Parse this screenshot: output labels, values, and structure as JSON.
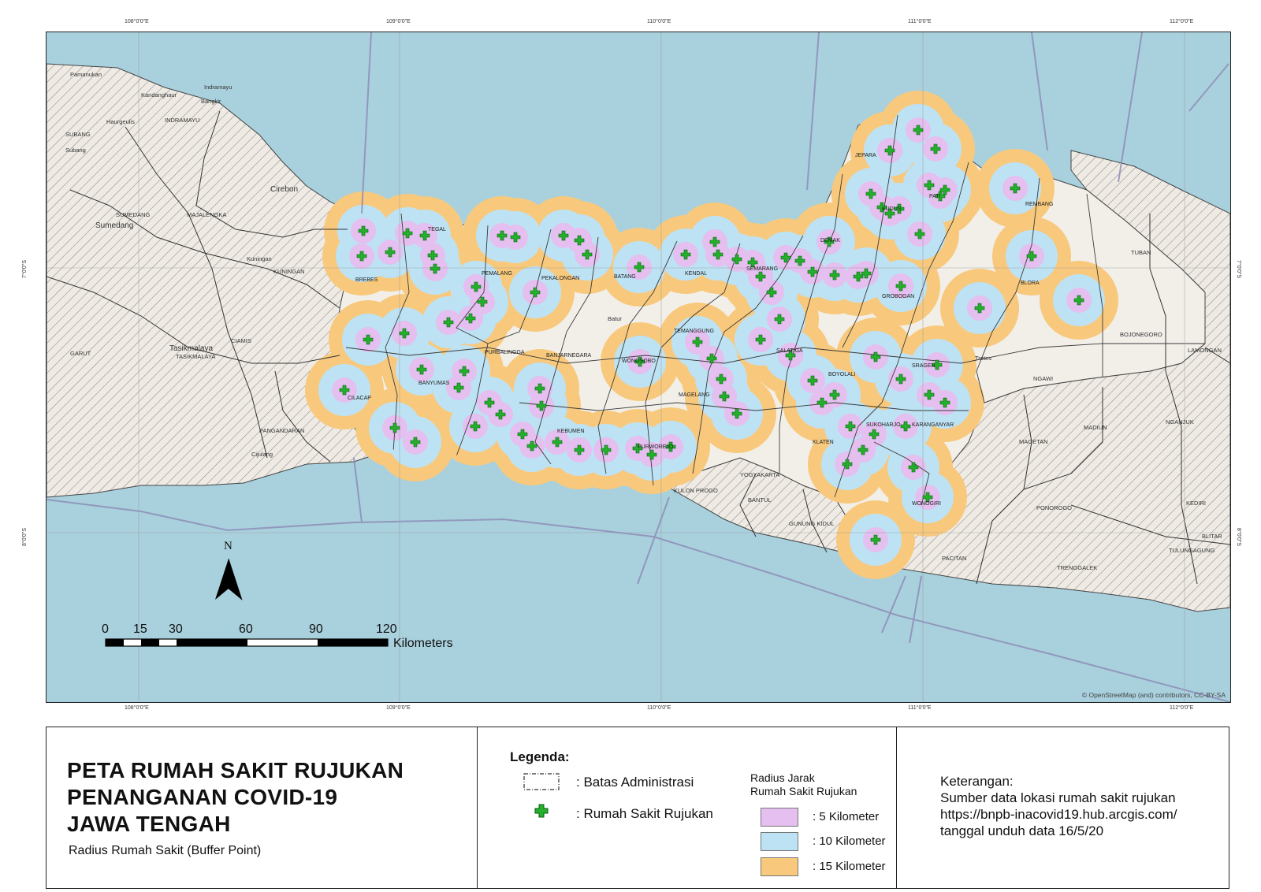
{
  "map": {
    "lon_labels": [
      "108°0'0\"E",
      "109°0'0\"E",
      "110°0'0\"E",
      "111°0'0\"E",
      "112°0'0\"E"
    ],
    "lat_labels": [
      "7°0'0\"S",
      "8°0'0\"S"
    ],
    "attribution": "© OpenStreetMap (and) contributors, CC-BY-SA",
    "north_label": "N",
    "scale": {
      "ticks": [
        "0",
        "15",
        "30",
        "60",
        "90",
        "120"
      ],
      "unit": "Kilometers"
    },
    "labels_jateng": [
      "BREBES",
      "TEGAL",
      "PEMALANG",
      "PEKALONGAN",
      "BATANG",
      "KENDAL",
      "SEMARANG",
      "DEMAK",
      "KUDUS",
      "JEPARA",
      "PATI",
      "REMBANG",
      "BLORA",
      "GROBOGAN",
      "CILACAP",
      "BANYUMAS",
      "PURBALINGGA",
      "BANJARNEGARA",
      "WONOSOBO",
      "TEMANGGUNG",
      "MAGELANG",
      "KEBUMEN",
      "PURWOREJO",
      "BOYOLALI",
      "SRAGEN",
      "KARANGANYAR",
      "SUKOHARJO",
      "KLATEN",
      "WONOGIRI",
      "SALATIGA"
    ],
    "labels_outside": [
      "Pamanukan",
      "Indramayu",
      "Kandanghaur",
      "Bangkir",
      "INDRAMAYU",
      "Haurgeulis",
      "SUBANG",
      "Subang",
      "Sumedang",
      "SUMEDANG",
      "MAJALENGKA",
      "Cirebon",
      "KUNINGAN",
      "Kuningan",
      "Tasikmalaya",
      "TASIKMALAYA",
      "CIAMIS",
      "GARUT",
      "PANGANDARAN",
      "Cijulang",
      "KULON PROGO",
      "YOGYAKARTA",
      "BANTUL",
      "GUNUNG KIDUL",
      "PACITAN",
      "TRENGGALEK",
      "PONOROGO",
      "MAGETAN",
      "MADIUN",
      "NGAWI",
      "BOJONEGORO",
      "TUBAN",
      "LAMONGAN",
      "KEDIRI",
      "TULUNGAGUNG",
      "BLITAR",
      "NGANJUK",
      "Tretes",
      "Batur"
    ]
  },
  "title": {
    "lines": [
      "PETA RUMAH SAKIT RUJUKAN",
      "PENANGANAN COVID-19",
      "JAWA TENGAH"
    ],
    "subtitle": "Radius Rumah Sakit (Buffer Point)"
  },
  "legend": {
    "heading": "Legenda:",
    "admin_label": ": Batas Administrasi",
    "hospital_label": ": Rumah Sakit Rujukan",
    "radius_title_1": "Radius Jarak",
    "radius_title_2": "Rumah Sakit Rujukan",
    "items": [
      {
        "label": ": 5 Kilometer",
        "color": "#e4bff0"
      },
      {
        "label": ": 10 Kilometer",
        "color": "#bde2f4"
      },
      {
        "label": ": 15 Kilometer",
        "color": "#f8c97c"
      }
    ]
  },
  "notes": {
    "heading": "Keterangan:",
    "line1": "Sumber data lokasi rumah sakit rujukan",
    "line2": "https://bnpb-inacovid19.hub.arcgis.com/",
    "line3": "tanggal unduh data 16/5/20"
  },
  "colors": {
    "sea": "#a9d0dd",
    "land_hatched": "#efebe4",
    "land_central_java": "#f2efe9",
    "buffer_5km": "#e4bff0",
    "buffer_10km": "#bde2f4",
    "buffer_15km": "#f8c97c",
    "hospital_cross": "#23b02a"
  }
}
